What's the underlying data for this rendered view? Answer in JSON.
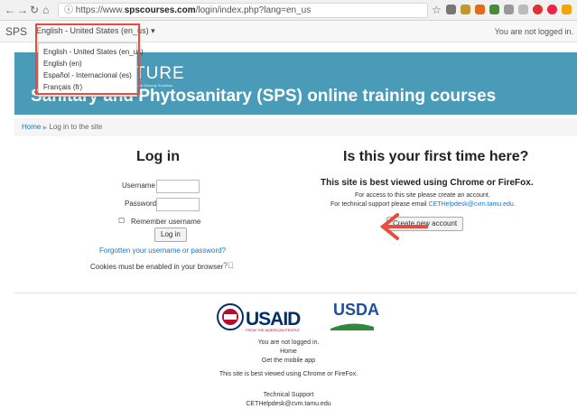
{
  "browser": {
    "url_prefix": "https://www.",
    "url_domain": "spscourses.com",
    "url_path": "/login/index.php?lang=en_us"
  },
  "topbar": {
    "brand": "SPS",
    "lang_current": "English - United States (en_us) ▾",
    "not_logged": "You are not logged in."
  },
  "lang_menu": [
    "English - United States (en_us)",
    "English (en)",
    "Español - Internacional (es)",
    "Français (fr)"
  ],
  "banner": {
    "logo": "TURE",
    "logo_small": "Food Security Solutions",
    "title": "Sanitary and Phytosanitary (SPS) online training courses"
  },
  "breadcrumb": {
    "home": "Home",
    "sep": "▶",
    "current": "Log in to the site"
  },
  "login": {
    "heading": "Log in",
    "username_label": "Username",
    "password_label": "Password",
    "remember_label": "Remember username",
    "submit": "Log in",
    "forgot": "Forgotten your username or password?",
    "cookies": "Cookies must be enabled in your browser"
  },
  "first_time": {
    "heading": "Is this your first time here?",
    "best": "This site is best viewed using Chrome or FireFox.",
    "line1": "For access to this site please create an account.",
    "line2_prefix": "For technical support please email ",
    "email": "CETHelpdesk@cvm.tamu.edu.",
    "create": "Create new account"
  },
  "footer": {
    "usaid": "USAID",
    "usaid_sub": "FROM THE AMERICAN PEOPLE",
    "usda": "USDA",
    "not_logged": "You are not logged in.",
    "home": "Home",
    "mobile": "Get the mobile app",
    "best": "This site is best viewed using Chrome or FireFox.",
    "support": "Technical Support",
    "email": "CETHelpdesk@cvm.tamu.edu"
  },
  "colors": {
    "banner": "#4a9bb7",
    "link": "#1177d1",
    "highlight": "#e74c3c"
  }
}
